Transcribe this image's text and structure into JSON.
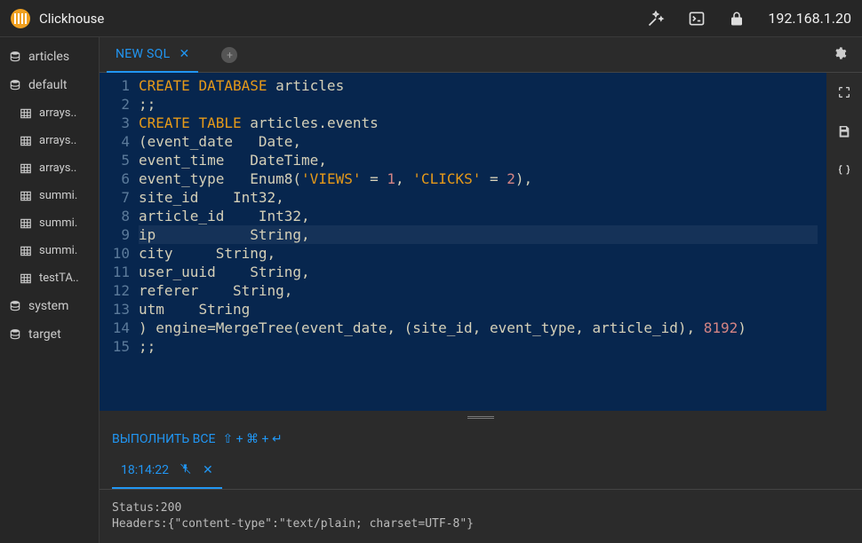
{
  "header": {
    "app_title": "Clickhouse",
    "ip": "192.168.1.20"
  },
  "sidebar": {
    "items": [
      {
        "label": "articles",
        "type": "db"
      },
      {
        "label": "default",
        "type": "db"
      },
      {
        "label": "arrays..",
        "type": "table",
        "child": true
      },
      {
        "label": "arrays..",
        "type": "table",
        "child": true
      },
      {
        "label": "arrays..",
        "type": "table",
        "child": true
      },
      {
        "label": "summi.",
        "type": "table",
        "child": true
      },
      {
        "label": "summi.",
        "type": "table",
        "child": true
      },
      {
        "label": "summi.",
        "type": "table",
        "child": true
      },
      {
        "label": "testTA..",
        "type": "table",
        "child": true
      },
      {
        "label": "system",
        "type": "db"
      },
      {
        "label": "target",
        "type": "db"
      }
    ]
  },
  "tabs": {
    "active_label": "NEW SQL"
  },
  "editor": {
    "lines": [
      {
        "n": 1,
        "tokens": [
          {
            "t": "CREATE",
            "c": "kw"
          },
          {
            "t": " ",
            "c": "plain"
          },
          {
            "t": "DATABASE",
            "c": "kw"
          },
          {
            "t": " articles",
            "c": "plain"
          }
        ]
      },
      {
        "n": 2,
        "tokens": [
          {
            "t": ";;",
            "c": "plain"
          }
        ]
      },
      {
        "n": 3,
        "tokens": [
          {
            "t": "CREATE",
            "c": "kw"
          },
          {
            "t": " ",
            "c": "plain"
          },
          {
            "t": "TABLE",
            "c": "kw"
          },
          {
            "t": " articles.events",
            "c": "plain"
          }
        ]
      },
      {
        "n": 4,
        "tokens": [
          {
            "t": "(event_date   ",
            "c": "plain"
          },
          {
            "t": "Date",
            "c": "type"
          },
          {
            "t": ",",
            "c": "plain"
          }
        ]
      },
      {
        "n": 5,
        "tokens": [
          {
            "t": "event_time   ",
            "c": "plain"
          },
          {
            "t": "DateTime",
            "c": "type"
          },
          {
            "t": ",",
            "c": "plain"
          }
        ]
      },
      {
        "n": 6,
        "tokens": [
          {
            "t": "event_type   ",
            "c": "plain"
          },
          {
            "t": "Enum8",
            "c": "type"
          },
          {
            "t": "(",
            "c": "plain"
          },
          {
            "t": "'VIEWS'",
            "c": "str"
          },
          {
            "t": " = ",
            "c": "plain"
          },
          {
            "t": "1",
            "c": "num"
          },
          {
            "t": ", ",
            "c": "plain"
          },
          {
            "t": "'CLICKS'",
            "c": "str"
          },
          {
            "t": " = ",
            "c": "plain"
          },
          {
            "t": "2",
            "c": "num"
          },
          {
            "t": "),",
            "c": "plain"
          }
        ]
      },
      {
        "n": 7,
        "tokens": [
          {
            "t": "site_id    ",
            "c": "plain"
          },
          {
            "t": "Int32",
            "c": "type"
          },
          {
            "t": ",",
            "c": "plain"
          }
        ]
      },
      {
        "n": 8,
        "tokens": [
          {
            "t": "article_id    ",
            "c": "plain"
          },
          {
            "t": "Int32",
            "c": "type"
          },
          {
            "t": ",",
            "c": "plain"
          }
        ]
      },
      {
        "n": 9,
        "hl": true,
        "tokens": [
          {
            "t": "ip           ",
            "c": "plain"
          },
          {
            "t": "String",
            "c": "type"
          },
          {
            "t": ",",
            "c": "plain"
          }
        ]
      },
      {
        "n": 10,
        "tokens": [
          {
            "t": "city     ",
            "c": "plain"
          },
          {
            "t": "String",
            "c": "type"
          },
          {
            "t": ",",
            "c": "plain"
          }
        ]
      },
      {
        "n": 11,
        "tokens": [
          {
            "t": "user_uuid    ",
            "c": "plain"
          },
          {
            "t": "String",
            "c": "type"
          },
          {
            "t": ",",
            "c": "plain"
          }
        ]
      },
      {
        "n": 12,
        "tokens": [
          {
            "t": "referer    ",
            "c": "plain"
          },
          {
            "t": "String",
            "c": "type"
          },
          {
            "t": ",",
            "c": "plain"
          }
        ]
      },
      {
        "n": 13,
        "tokens": [
          {
            "t": "utm    ",
            "c": "plain"
          },
          {
            "t": "String",
            "c": "type"
          }
        ]
      },
      {
        "n": 14,
        "tokens": [
          {
            "t": ") engine=MergeTree(event_date, (site_id, event_type, article_id), ",
            "c": "plain"
          },
          {
            "t": "8192",
            "c": "num"
          },
          {
            "t": ")",
            "c": "plain"
          }
        ]
      },
      {
        "n": 15,
        "tokens": [
          {
            "t": ";;",
            "c": "plain"
          }
        ]
      }
    ]
  },
  "runbar": {
    "label": "ВЫПОЛНИТЬ ВСЕ",
    "hint": "⇧ + ⌘ + ↵"
  },
  "results": {
    "tab_label": "18:14:22",
    "status_line": "Status:200",
    "headers_line": "Headers:{\"content-type\":\"text/plain; charset=UTF-8\"}"
  }
}
